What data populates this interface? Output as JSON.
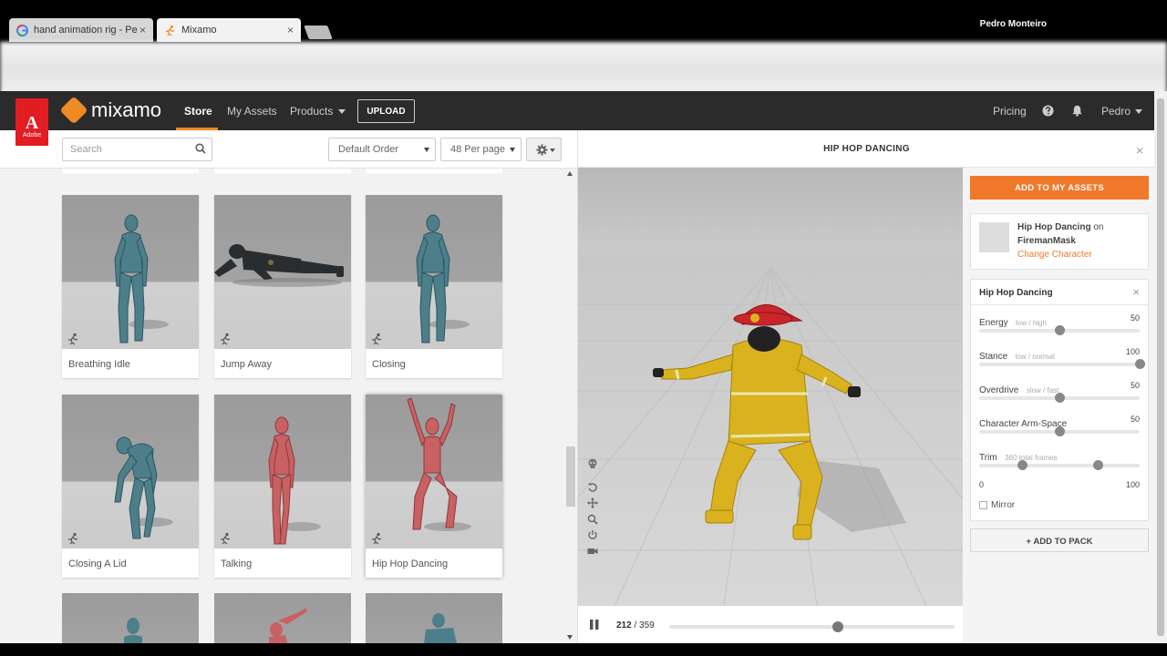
{
  "browser": {
    "tabs": [
      {
        "title": "hand animation rig - Pe",
        "icon": "google-icon",
        "active": false
      },
      {
        "title": "Mixamo",
        "icon": "mixamo-runner-icon",
        "active": true
      }
    ],
    "close_glyph": "×",
    "profile_name": "Pedro Monteiro"
  },
  "header": {
    "adobe_letter": "A",
    "adobe_label": "Adobe",
    "logo_text": "mixamo",
    "nav": {
      "store": "Store",
      "my_assets": "My Assets",
      "products": "Products"
    },
    "upload_label": "UPLOAD",
    "pricing": "Pricing",
    "user": "Pedro",
    "accent_color": "#f08a25"
  },
  "toolbar": {
    "search_placeholder": "Search",
    "order_select": "Default Order",
    "per_page_select": "48 Per page"
  },
  "animations": [
    {
      "name": "Breathing Idle",
      "figure": "blue-idle"
    },
    {
      "name": "Jump Away",
      "figure": "soldier-prone"
    },
    {
      "name": "Closing",
      "figure": "blue-standing"
    },
    {
      "name": "Closing A Lid",
      "figure": "blue-bending"
    },
    {
      "name": "Talking",
      "figure": "red-standing"
    },
    {
      "name": "Hip Hop Dancing",
      "figure": "red-arms-up",
      "selected": true
    }
  ],
  "preview": {
    "title": "HIP HOP DANCING",
    "current_frame": "212",
    "total_frames": "/ 359",
    "progress": 0.59
  },
  "side": {
    "add_button": "ADD TO MY ASSETS",
    "anim_name": "Hip Hop Dancing",
    "on_word": "on",
    "character": "FiremanMask",
    "change_character": "Change Character",
    "params_title": "Hip Hop Dancing",
    "params": [
      {
        "label": "Energy",
        "hint": "low / high",
        "value": "50",
        "fraction": 0.5
      },
      {
        "label": "Stance",
        "hint": "low / normal",
        "value": "100",
        "fraction": 1.0
      },
      {
        "label": "Overdrive",
        "hint": "slow / fast",
        "value": "50",
        "fraction": 0.5
      },
      {
        "label": "Character Arm-Space",
        "hint": "",
        "value": "50",
        "fraction": 0.5
      },
      {
        "label": "Trim",
        "hint": "360 total frames",
        "value": "",
        "range": [
          0.27,
          0.74
        ]
      }
    ],
    "trim_min": "0",
    "trim_max": "100",
    "mirror_label": "Mirror",
    "pack_button": "ADD TO PACK",
    "pack_plus": "+"
  }
}
